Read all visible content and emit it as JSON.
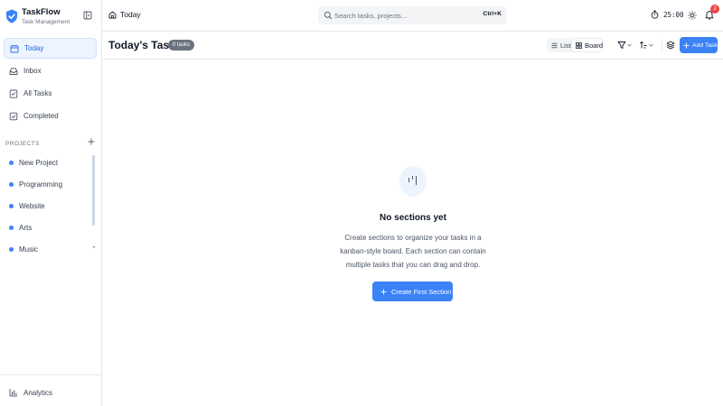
{
  "app": {
    "name": "TaskFlow",
    "subtitle": "Task Management",
    "accent": "#3b82f6"
  },
  "sidebar": {
    "nav": [
      {
        "label": "Today",
        "icon": "calendar-icon",
        "active": true
      },
      {
        "label": "Inbox",
        "icon": "inbox-icon",
        "active": false
      },
      {
        "label": "All Tasks",
        "icon": "checklist-icon",
        "active": false
      },
      {
        "label": "Completed",
        "icon": "check-square-icon",
        "active": false
      }
    ],
    "projects_title": "PROJECTS",
    "projects": [
      {
        "label": "New Project",
        "color": "#3b82f6"
      },
      {
        "label": "Programming",
        "color": "#3b82f6"
      },
      {
        "label": "Website",
        "color": "#3b82f6"
      },
      {
        "label": "Arts",
        "color": "#3b82f6"
      },
      {
        "label": "Music",
        "color": "#3b82f6"
      }
    ],
    "analytics_label": "Analytics"
  },
  "topbar": {
    "breadcrumb": "Today",
    "search_placeholder": "Search tasks, projects...",
    "search_shortcut": "Ctrl+K",
    "timer": "25:00",
    "notification_count": "2"
  },
  "main": {
    "title": "Today's Tasks",
    "task_count": "0 tasks",
    "view_list": "List",
    "view_board": "Board",
    "active_view": "Board",
    "add_task": "Add Task"
  },
  "empty_state": {
    "title": "No sections yet",
    "description": "Create sections to organize your tasks in a kanban-style board. Each section can contain multiple tasks that you can drag and drop.",
    "cta": "Create First Section"
  }
}
